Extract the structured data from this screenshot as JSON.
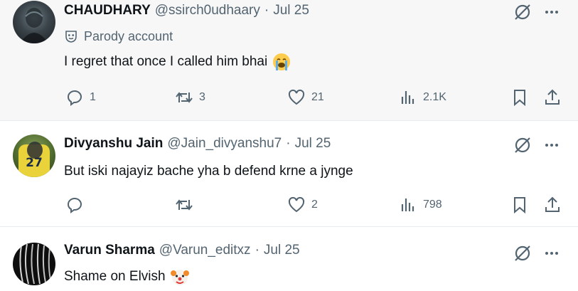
{
  "tweets": [
    {
      "name": "CHAUDHARY",
      "handle": "@ssirch0udhaary",
      "separator": "·",
      "date": "Jul 25",
      "label": "Parody account",
      "text": "I regret that once I called him bhai",
      "emoji": "loudly-crying-face",
      "replies": "1",
      "reposts": "3",
      "likes": "21",
      "views": "2.1K"
    },
    {
      "name": "Divyanshu Jain",
      "handle": "@Jain_divyanshu7",
      "separator": "·",
      "date": "Jul 25",
      "avatar_number": "27",
      "text": "But iski najayiz bache yha b defend krne a jynge",
      "replies": "",
      "reposts": "",
      "likes": "2",
      "views": "798"
    },
    {
      "name": "Varun Sharma",
      "handle": "@Varun_editxz",
      "separator": "·",
      "date": "Jul 25",
      "text": "Shame on Elvish",
      "emoji": "clown-face"
    }
  ],
  "icons": {
    "more": "more-icon",
    "grok": "grok-icon",
    "reply": "reply-icon",
    "repost": "repost-icon",
    "like": "like-icon",
    "views": "views-icon",
    "bookmark": "bookmark-icon",
    "share": "share-icon",
    "parody": "parody-mask-icon"
  },
  "colors": {
    "text": "#0f1419",
    "secondary": "#536471",
    "highlight_bg": "#f7f7f7",
    "border": "#e6ecf0"
  }
}
